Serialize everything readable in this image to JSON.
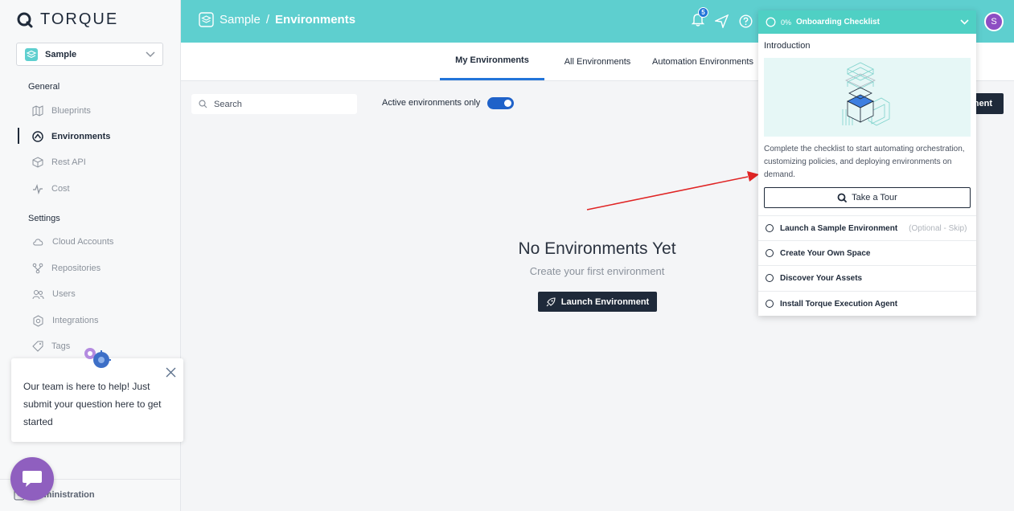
{
  "sidebar": {
    "brand": "TORQUE",
    "space": "Sample",
    "general_label": "General",
    "general_items": [
      {
        "label": "Blueprints",
        "icon": "map-icon"
      },
      {
        "label": "Environments",
        "icon": "environments-icon",
        "active": true
      },
      {
        "label": "Rest API",
        "icon": "cube-icon"
      },
      {
        "label": "Cost",
        "icon": "pulse-icon"
      }
    ],
    "settings_label": "Settings",
    "settings_items": [
      {
        "label": "Cloud Accounts",
        "icon": "cloud-icon"
      },
      {
        "label": "Repositories",
        "icon": "git-icon"
      },
      {
        "label": "Users",
        "icon": "users-icon"
      },
      {
        "label": "Integrations",
        "icon": "integrations-icon"
      },
      {
        "label": "Tags",
        "icon": "tag-icon"
      }
    ],
    "admin_label": "Administration"
  },
  "help_popup": {
    "text": "Our team is here to help! Just submit your question here to get started"
  },
  "header": {
    "space": "Sample",
    "separator": "/",
    "page": "Environments",
    "notification_count": "5",
    "avatar_initial": "S"
  },
  "tabs": [
    {
      "label": "My Environments",
      "active": true
    },
    {
      "label": "All Environments"
    },
    {
      "label": "Automation Environments"
    }
  ],
  "toolbar": {
    "search_placeholder": "Search",
    "toggle_label": "Active environments only",
    "toggle_on": true,
    "launch_partial": "nent"
  },
  "empty_state": {
    "title": "No Environments Yet",
    "subtitle": "Create your first environment",
    "button": "Launch Environment"
  },
  "onboarding": {
    "percent": "0%",
    "title": "Onboarding Checklist",
    "intro_label": "Introduction",
    "intro_text": "Complete the checklist to start automating orchestration, customizing policies, and deploying environments on demand.",
    "tour_button": "Take a Tour",
    "items": [
      {
        "label": "Launch a Sample Environment",
        "optional": "(Optional - Skip)"
      },
      {
        "label": "Create Your Own Space"
      },
      {
        "label": "Discover Your Assets"
      },
      {
        "label": "Install Torque Execution Agent"
      }
    ]
  },
  "colors": {
    "header_bg": "#5ecfcf",
    "onboard_head": "#4fd0c4",
    "primary_dark": "#1f2a3a",
    "accent_blue": "#2274d9",
    "avatar": "#8d4ec3",
    "arrow": "#e02424"
  }
}
